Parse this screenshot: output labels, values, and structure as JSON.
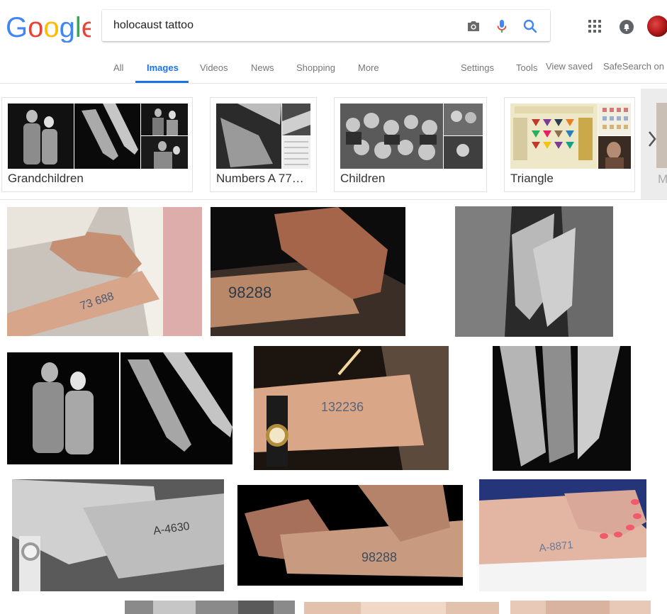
{
  "search": {
    "query": "holocaust tattoo",
    "logo_text": "Google",
    "logo_colors": [
      "#4285F4",
      "#EA4335",
      "#FBBC05",
      "#4285F4",
      "#34A853",
      "#EA4335"
    ]
  },
  "header_icons": [
    "camera-icon",
    "microphone-icon",
    "search-icon",
    "apps-icon",
    "notifications-icon"
  ],
  "tabs": {
    "items": [
      "All",
      "Images",
      "Videos",
      "News",
      "Shopping",
      "More"
    ],
    "active": "Images",
    "settings": "Settings",
    "tools": "Tools",
    "view_saved": "View saved",
    "safesearch": "SafeSearch on"
  },
  "related_searches": [
    {
      "label": "Grandchildren"
    },
    {
      "label": "Numbers A 77…"
    },
    {
      "label": "Children"
    },
    {
      "label": "Triangle"
    }
  ],
  "colors": {
    "accent": "#1a73e8",
    "tab_text": "#777777",
    "chip_border": "#e2e2e2"
  }
}
